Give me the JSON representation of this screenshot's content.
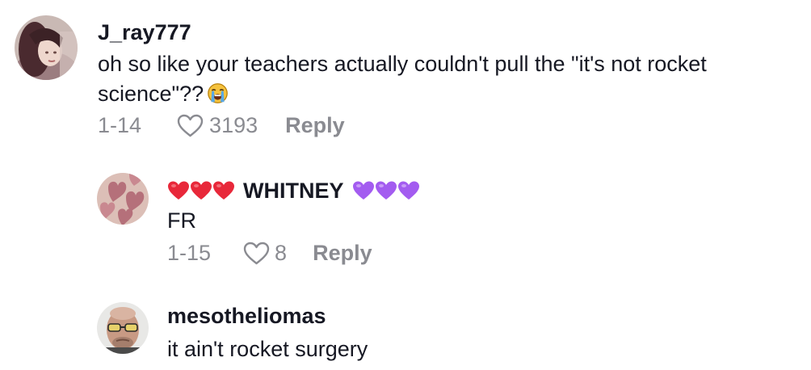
{
  "comments": [
    {
      "username": "J_ray777",
      "text_line1": "oh so like your teachers actually couldn't pull the \"it's not rocket",
      "text_line2": "science\"??",
      "emoji": "crying-face",
      "date": "1-14",
      "likes": "3193",
      "reply_label": "Reply"
    },
    {
      "username_prefix_emoji": "red-hearts",
      "username": "WHITNEY",
      "username_suffix_emoji": "purple-hearts",
      "text": "FR",
      "date": "1-15",
      "likes": "8",
      "reply_label": "Reply"
    },
    {
      "username": "mesotheliomas",
      "text": "it ain't rocket surgery"
    }
  ],
  "colors": {
    "text": "#161823",
    "meta": "#8a8b91",
    "red_heart": "#e8283a",
    "purple_heart": "#a35cf0"
  }
}
